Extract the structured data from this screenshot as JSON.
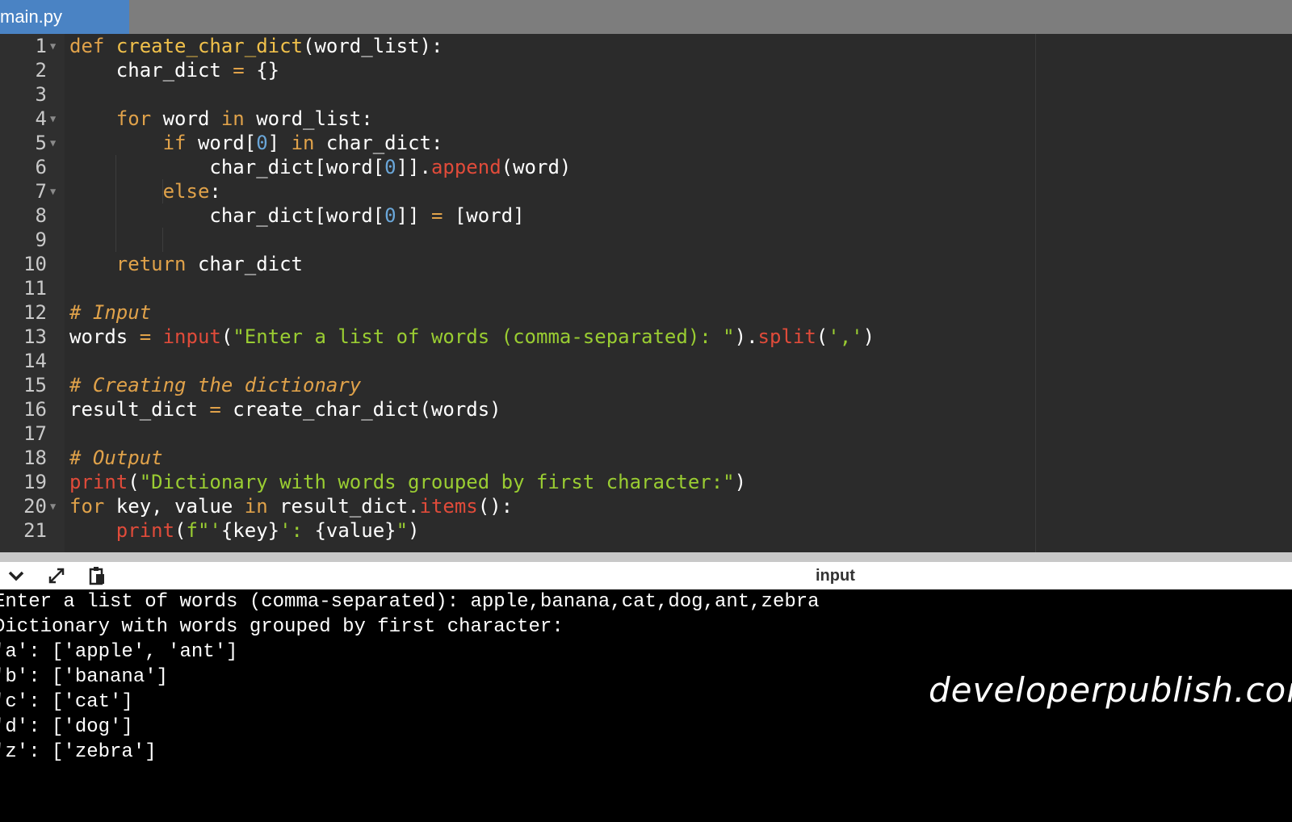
{
  "tab": {
    "label": "main.py"
  },
  "editor": {
    "line_numbers": [
      "1",
      "2",
      "3",
      "4",
      "5",
      "6",
      "7",
      "8",
      "9",
      "10",
      "11",
      "12",
      "13",
      "14",
      "15",
      "16",
      "17",
      "18",
      "19",
      "20",
      "21"
    ]
  },
  "code": {
    "l1": {
      "def": "def",
      "name": "create_char_dict",
      "rest": "(word_list):"
    },
    "l2": {
      "a": "    char_dict ",
      "eq": "=",
      "b": " {}"
    },
    "l4": {
      "for": "for",
      "a": " word ",
      "in": "in",
      "b": " word_list:"
    },
    "l5": {
      "if": "if",
      "a": " word[",
      "num": "0",
      "b": "] ",
      "in": "in",
      "c": " char_dict:"
    },
    "l6": {
      "a": "char_dict[word[",
      "num": "0",
      "b": "]].",
      "fn": "append",
      "c": "(word)"
    },
    "l7": {
      "else": "else",
      "a": ":"
    },
    "l8": {
      "a": "char_dict[word[",
      "num": "0",
      "b": "]] ",
      "eq": "=",
      "c": " [word]"
    },
    "l10": {
      "ret": "return",
      "a": " char_dict"
    },
    "l12": {
      "comment": "# Input"
    },
    "l13": {
      "a": "words ",
      "eq": "=",
      "sp": " ",
      "fn": "input",
      "b": "(",
      "str": "\"Enter a list of words (comma-separated): \"",
      "c": ").",
      "fn2": "split",
      "d": "(",
      "str2": "','",
      "e": ")"
    },
    "l15": {
      "comment": "# Creating the dictionary"
    },
    "l16": {
      "a": "result_dict ",
      "eq": "=",
      "b": " create_char_dict(words)"
    },
    "l18": {
      "comment": "# Output"
    },
    "l19": {
      "fn": "print",
      "a": "(",
      "str": "\"Dictionary with words grouped by first character:\"",
      "b": ")"
    },
    "l20": {
      "for": "for",
      "a": " key, value ",
      "in": "in",
      "b": " result_dict.",
      "fn": "items",
      "c": "():"
    },
    "l21": {
      "fn": "print",
      "a": "(",
      "str": "f\"'",
      "b": "{key}",
      "str2": "': ",
      "c": "{value}",
      "str3": "\"",
      "d": ")"
    }
  },
  "console": {
    "title": "input",
    "lines": [
      "Enter a list of words (comma-separated): apple,banana,cat,dog,ant,zebra",
      "Dictionary with words grouped by first character:",
      "'a': ['apple', 'ant']",
      "'b': ['banana']",
      "'c': ['cat']",
      "'d': ['dog']",
      "'z': ['zebra']"
    ],
    "watermark": "developerpublish.com"
  },
  "icons": {
    "collapse": "chevron-down-icon",
    "expand": "expand-icon",
    "copy": "clipboard-icon"
  }
}
